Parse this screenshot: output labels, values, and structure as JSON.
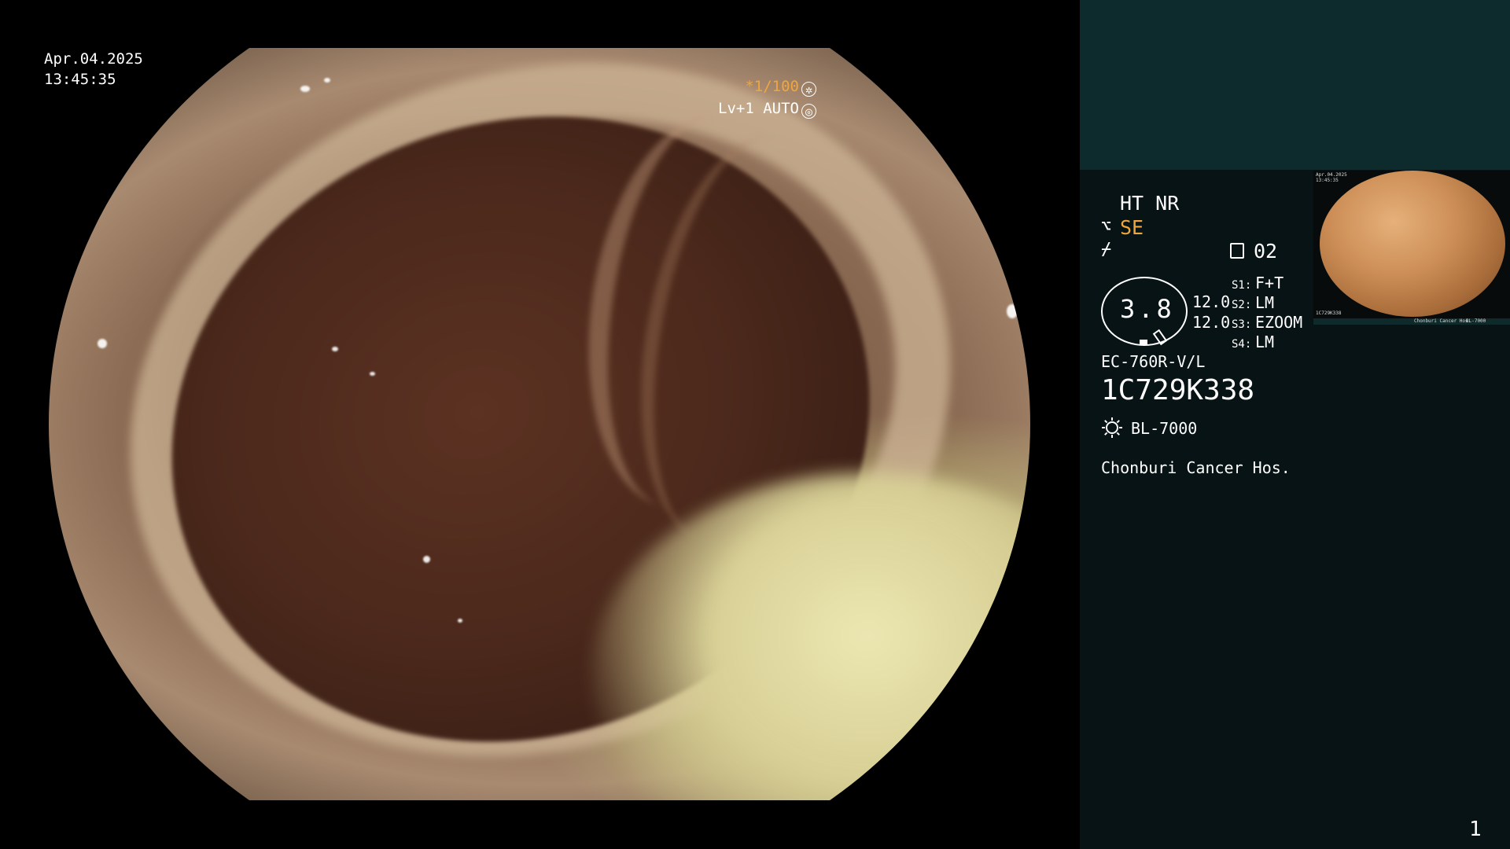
{
  "capture": {
    "date": "Apr.04.2025",
    "time": "13:45:35"
  },
  "video_overlay": {
    "exposure": "*1/100",
    "level": "Lv+1 AUTO"
  },
  "info_panel": {
    "enhancement": "HT NR",
    "mode": "SE",
    "preset_number": "02",
    "gauge_value": "3.8",
    "side_values": [
      "12.0",
      "12.0"
    ],
    "settings": [
      {
        "key": "S1:",
        "value": "F+T"
      },
      {
        "key": "S2:",
        "value": "LM"
      },
      {
        "key": "S3:",
        "value": "EZOOM"
      },
      {
        "key": "S4:",
        "value": "LM"
      }
    ],
    "scope_model": "EC-760R-V/L",
    "scope_serial": "1C729K338",
    "light_source": "BL-7000",
    "hospital": "Chonburi Cancer Hos."
  },
  "thumbnail": {
    "date": "Apr.04.2025",
    "time": "13:45:35",
    "serial": "1C729K338",
    "footer": "Chonburi Cancer Hos.",
    "light": "BL-7000"
  },
  "page_number": "1",
  "colors": {
    "accent_orange": "#f0a63c",
    "panel_dark": "#071314",
    "panel_header": "#0d2a2c"
  }
}
